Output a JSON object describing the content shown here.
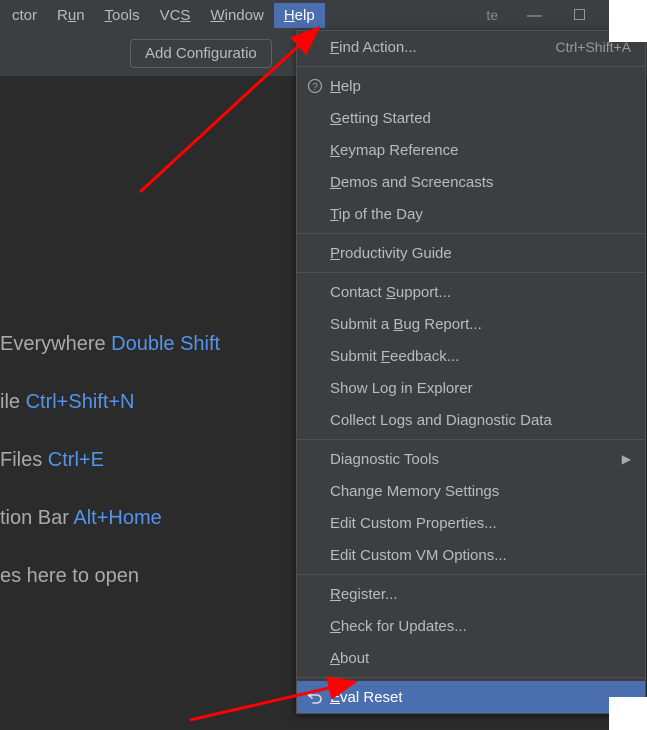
{
  "menubar": {
    "items": [
      {
        "html": "ctor"
      },
      {
        "html": "R<u>u</u>n"
      },
      {
        "html": "<u>T</u>ools"
      },
      {
        "html": "VC<u>S</u>"
      },
      {
        "html": "<u>W</u>indow"
      },
      {
        "html": "<u>H</u>elp",
        "highlighted": true
      }
    ],
    "title": "te",
    "minimize": "—",
    "maximize": "☐",
    "close": "✕"
  },
  "toolbar": {
    "add_config": "Add Configuratio"
  },
  "welcome": {
    "l1_a": "Everywhere  ",
    "l1_b": "Double Shift",
    "l2_a": "ile  ",
    "l2_b": "Ctrl+Shift+N",
    "l3_a": " Files  ",
    "l3_b": "Ctrl+E",
    "l4_a": "tion Bar  ",
    "l4_b": "Alt+Home",
    "l5": "es here to open"
  },
  "help_menu": {
    "groups": [
      [
        {
          "html": "<u>F</u>ind Action...",
          "shortcut": "Ctrl+Shift+A"
        }
      ],
      [
        {
          "html": "<u>H</u>elp",
          "icon": "question"
        },
        {
          "html": "<u>G</u>etting Started"
        },
        {
          "html": "<u>K</u>eymap Reference"
        },
        {
          "html": "<u>D</u>emos and Screencasts"
        },
        {
          "html": "<u>T</u>ip of the Day"
        }
      ],
      [
        {
          "html": "<u>P</u>roductivity Guide"
        }
      ],
      [
        {
          "html": "Contact <u>S</u>upport..."
        },
        {
          "html": "Submit a <u>B</u>ug Report..."
        },
        {
          "html": "Submit <u>F</u>eedback..."
        },
        {
          "html": "Show Log in Explorer"
        },
        {
          "html": "Collect Logs and Diagnostic Data"
        }
      ],
      [
        {
          "html": "Diagnostic Tools",
          "submenu": true
        },
        {
          "html": "Change Memory Settings"
        },
        {
          "html": "Edit Custom Properties..."
        },
        {
          "html": "Edit Custom VM Options..."
        }
      ],
      [
        {
          "html": "<u>R</u>egister..."
        },
        {
          "html": "<u>C</u>heck for Updates..."
        },
        {
          "html": "<u>A</u>bout"
        }
      ],
      [
        {
          "html": "<u>E</u>val Reset",
          "icon": "undo",
          "selected": true
        }
      ]
    ]
  }
}
